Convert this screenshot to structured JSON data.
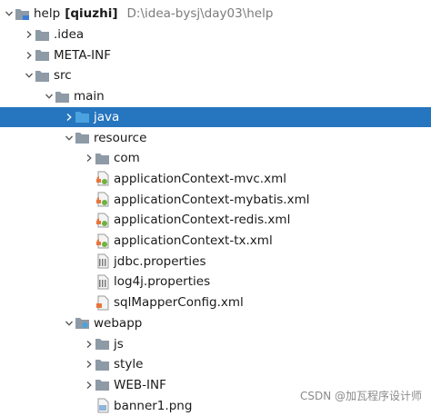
{
  "project": {
    "name": "help",
    "module": "[qiuzhi]",
    "path": "D:\\idea-bysj\\day03\\help"
  },
  "tree": [
    {
      "label": "help",
      "depth": 0,
      "arrow": "down",
      "icon": "module-folder-icon",
      "root": true
    },
    {
      "label": ".idea",
      "depth": 1,
      "arrow": "right",
      "icon": "folder-icon"
    },
    {
      "label": "META-INF",
      "depth": 1,
      "arrow": "right",
      "icon": "folder-icon"
    },
    {
      "label": "src",
      "depth": 1,
      "arrow": "down",
      "icon": "folder-icon"
    },
    {
      "label": "main",
      "depth": 2,
      "arrow": "down",
      "icon": "folder-icon"
    },
    {
      "label": "java",
      "depth": 3,
      "arrow": "right",
      "icon": "source-folder-icon",
      "selected": true
    },
    {
      "label": "resource",
      "depth": 3,
      "arrow": "down",
      "icon": "folder-icon"
    },
    {
      "label": "com",
      "depth": 4,
      "arrow": "right",
      "icon": "folder-icon"
    },
    {
      "label": "applicationContext-mvc.xml",
      "depth": 4,
      "arrow": "none",
      "icon": "spring-xml-icon"
    },
    {
      "label": "applicationContext-mybatis.xml",
      "depth": 4,
      "arrow": "none",
      "icon": "spring-xml-icon"
    },
    {
      "label": "applicationContext-redis.xml",
      "depth": 4,
      "arrow": "none",
      "icon": "spring-xml-icon"
    },
    {
      "label": "applicationContext-tx.xml",
      "depth": 4,
      "arrow": "none",
      "icon": "spring-xml-icon"
    },
    {
      "label": "jdbc.properties",
      "depth": 4,
      "arrow": "none",
      "icon": "properties-file-icon"
    },
    {
      "label": "log4j.properties",
      "depth": 4,
      "arrow": "none",
      "icon": "properties-file-icon"
    },
    {
      "label": "sqlMapperConfig.xml",
      "depth": 4,
      "arrow": "none",
      "icon": "xml-file-icon"
    },
    {
      "label": "webapp",
      "depth": 3,
      "arrow": "down",
      "icon": "web-folder-icon"
    },
    {
      "label": "js",
      "depth": 4,
      "arrow": "right",
      "icon": "folder-icon"
    },
    {
      "label": "style",
      "depth": 4,
      "arrow": "right",
      "icon": "folder-icon"
    },
    {
      "label": "WEB-INF",
      "depth": 4,
      "arrow": "right",
      "icon": "folder-icon"
    },
    {
      "label": "banner1.png",
      "depth": 4,
      "arrow": "none",
      "icon": "image-file-icon"
    }
  ],
  "colors": {
    "selection": "#2675bf",
    "folder": "#8e9aa6",
    "source_folder": "#4aa3df",
    "arrow": "#555555",
    "path_text": "#7b7b7b"
  },
  "watermark": "CSDN @加瓦程序设计师"
}
